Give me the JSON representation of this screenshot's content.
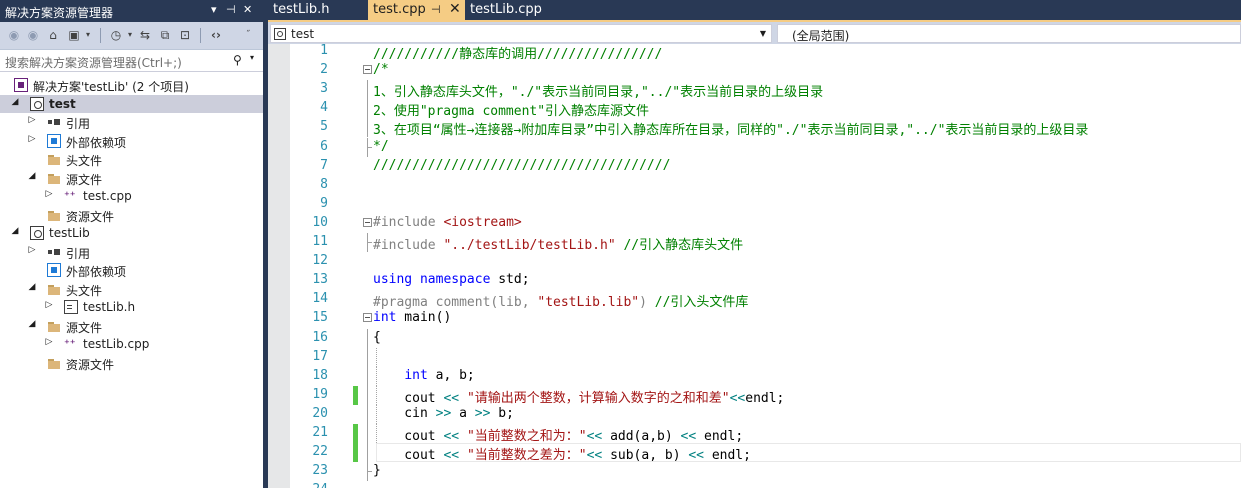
{
  "solution_explorer": {
    "title": "解决方案资源管理器",
    "title_controls": [
      "▾",
      "⊣",
      "✕"
    ],
    "search_placeholder": "搜索解决方案资源管理器(Ctrl+;)",
    "tree": [
      {
        "label": "解决方案'testLib' (2 个项目)",
        "icon": "solution-icon",
        "level": 0
      },
      {
        "label": "test",
        "icon": "project-icon",
        "level": 0,
        "expanded": true,
        "selected": true,
        "bold": true
      },
      {
        "label": "引用",
        "icon": "references-icon",
        "level": 1,
        "expander": "collapsed"
      },
      {
        "label": "外部依赖项",
        "icon": "external-deps-icon",
        "level": 1,
        "expander": "collapsed"
      },
      {
        "label": "头文件",
        "icon": "folder-icon",
        "level": 1
      },
      {
        "label": "源文件",
        "icon": "folder-icon",
        "level": 1,
        "expander": "expanded"
      },
      {
        "label": "test.cpp",
        "icon": "cpp-file-icon",
        "level": 2,
        "expander": "collapsed"
      },
      {
        "label": "资源文件",
        "icon": "folder-icon",
        "level": 1
      },
      {
        "label": "testLib",
        "icon": "project-icon",
        "level": 0,
        "expanded": true
      },
      {
        "label": "引用",
        "icon": "references-icon",
        "level": 1,
        "expander": "collapsed"
      },
      {
        "label": "外部依赖项",
        "icon": "external-deps-icon",
        "level": 1
      },
      {
        "label": "头文件",
        "icon": "folder-icon",
        "level": 1,
        "expander": "expanded"
      },
      {
        "label": "testLib.h",
        "icon": "header-file-icon",
        "level": 2,
        "expander": "collapsed"
      },
      {
        "label": "源文件",
        "icon": "folder-icon",
        "level": 1,
        "expander": "expanded"
      },
      {
        "label": "testLib.cpp",
        "icon": "cpp-file-icon",
        "level": 2,
        "expander": "collapsed"
      },
      {
        "label": "资源文件",
        "icon": "folder-icon",
        "level": 1
      }
    ]
  },
  "tabs": [
    {
      "label": "testLib.h",
      "active": false
    },
    {
      "label": "test.cpp",
      "active": true,
      "pin": "⊣",
      "close": "✕"
    },
    {
      "label": "testLib.cpp",
      "active": false
    }
  ],
  "nav": {
    "project": "test",
    "scope": "(全局范围)"
  },
  "colors": {
    "chrome": "#293955",
    "active_tab": "#f5cc84",
    "toolbar": "#cfd6e5",
    "line_number": "#2b91af",
    "comment": "#008000",
    "keyword": "#0000ff",
    "string": "#a31515",
    "changed_marker": "#57c746"
  },
  "code_lines": [
    {
      "n": "1",
      "segs": [
        {
          "c": "cm",
          "t": "///////////静态库的调用////////////////"
        }
      ]
    },
    {
      "n": "2",
      "fold": true,
      "segs": [
        {
          "c": "cm",
          "t": "/*"
        }
      ]
    },
    {
      "n": "3",
      "segs": [
        {
          "c": "cm",
          "t": "1、引入静态库头文件，\"./\"表示当前同目录,\"../\"表示当前目录的上级目录"
        }
      ]
    },
    {
      "n": "4",
      "segs": [
        {
          "c": "cm",
          "t": "2、使用\"pragma comment\"引入静态库源文件"
        }
      ]
    },
    {
      "n": "5",
      "segs": [
        {
          "c": "cm",
          "t": "3、在项目“属性→连接器→附加库目录”中引入静态库所在目录，同样的\"./\"表示当前同目录,\"../\"表示当前目录的上级目录"
        }
      ]
    },
    {
      "n": "6",
      "segs": [
        {
          "c": "cm",
          "t": "*/"
        }
      ]
    },
    {
      "n": "7",
      "segs": [
        {
          "c": "cm",
          "t": "//////////////////////////////////////"
        }
      ]
    },
    {
      "n": "8",
      "segs": []
    },
    {
      "n": "9",
      "segs": []
    },
    {
      "n": "10",
      "fold": true,
      "segs": [
        {
          "c": "pp",
          "t": "#include "
        },
        {
          "c": "st",
          "t": "<iostream>"
        }
      ]
    },
    {
      "n": "11",
      "segs": [
        {
          "c": "pp",
          "t": "#include "
        },
        {
          "c": "st",
          "t": "\"../testLib/testLib.h\""
        },
        {
          "c": "cm",
          "t": " //引入静态库头文件"
        }
      ]
    },
    {
      "n": "12",
      "segs": []
    },
    {
      "n": "13",
      "segs": [
        {
          "c": "kw",
          "t": "using namespace"
        },
        {
          "c": "",
          "t": " std;"
        }
      ]
    },
    {
      "n": "14",
      "segs": [
        {
          "c": "pp",
          "t": "#pragma comment(lib, "
        },
        {
          "c": "st",
          "t": "\"testLib.lib\""
        },
        {
          "c": "pp",
          "t": ")"
        },
        {
          "c": "cm",
          "t": " //引入头文件库"
        }
      ]
    },
    {
      "n": "15",
      "fold": true,
      "segs": [
        {
          "c": "kw",
          "t": "int"
        },
        {
          "c": "",
          "t": " main()"
        }
      ]
    },
    {
      "n": "16",
      "segs": [
        {
          "c": "",
          "t": "{"
        }
      ]
    },
    {
      "n": "17",
      "segs": []
    },
    {
      "n": "18",
      "segs": [
        {
          "c": "",
          "t": "    "
        },
        {
          "c": "kw",
          "t": "int"
        },
        {
          "c": "",
          "t": " a, b;"
        }
      ]
    },
    {
      "n": "19",
      "changed": true,
      "segs": [
        {
          "c": "",
          "t": "    cout "
        },
        {
          "c": "op",
          "t": "<<"
        },
        {
          "c": "",
          "t": " "
        },
        {
          "c": "st",
          "t": "\"请输出两个整数，计算输入数字的之和和差\""
        },
        {
          "c": "op",
          "t": "<<"
        },
        {
          "c": "",
          "t": "endl;"
        }
      ]
    },
    {
      "n": "20",
      "segs": [
        {
          "c": "",
          "t": "    cin "
        },
        {
          "c": "op",
          "t": ">>"
        },
        {
          "c": "",
          "t": " a "
        },
        {
          "c": "op",
          "t": ">>"
        },
        {
          "c": "",
          "t": " b;"
        }
      ]
    },
    {
      "n": "21",
      "changed": true,
      "segs": [
        {
          "c": "",
          "t": "    cout "
        },
        {
          "c": "op",
          "t": "<<"
        },
        {
          "c": "",
          "t": " "
        },
        {
          "c": "st",
          "t": "\"当前整数之和为：\""
        },
        {
          "c": "op",
          "t": "<<"
        },
        {
          "c": "",
          "t": " add(a,b) "
        },
        {
          "c": "op",
          "t": "<<"
        },
        {
          "c": "",
          "t": " endl;"
        }
      ]
    },
    {
      "n": "22",
      "changed": true,
      "current": true,
      "segs": [
        {
          "c": "",
          "t": "    cout "
        },
        {
          "c": "op",
          "t": "<<"
        },
        {
          "c": "",
          "t": " "
        },
        {
          "c": "st",
          "t": "\"当前整数之差为：\""
        },
        {
          "c": "op",
          "t": "<<"
        },
        {
          "c": "",
          "t": " sub(a, b) "
        },
        {
          "c": "op",
          "t": "<<"
        },
        {
          "c": "",
          "t": " endl;"
        }
      ]
    },
    {
      "n": "23",
      "segs": [
        {
          "c": "",
          "t": "}"
        }
      ]
    },
    {
      "n": "24",
      "segs": []
    }
  ]
}
